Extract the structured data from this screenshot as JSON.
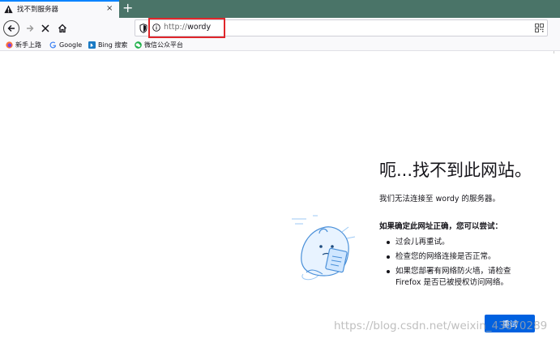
{
  "tab": {
    "title": "找不到服务器",
    "close": "×"
  },
  "tabstrip": {
    "new_tab": "+"
  },
  "urlbar": {
    "protocol": "http://",
    "host": "wordy"
  },
  "bookmarks": [
    {
      "label": "新手上路",
      "icon": "firefox-icon"
    },
    {
      "label": "Google",
      "icon": "google-icon"
    },
    {
      "label": "Bing 搜索",
      "icon": "bing-icon"
    },
    {
      "label": "微信公众平台",
      "icon": "wechat-icon"
    }
  ],
  "error": {
    "title": "呃...找不到此网站。",
    "description": "我们无法连接至 wordy 的服务器。",
    "tips_heading": "如果确定此网址正确，您可以尝试：",
    "tips": [
      "过会儿再重试。",
      "检查您的网络连接是否正常。",
      "如果您部署有网络防火墙，请检查",
      "Firefox 是否已被授权访问网络。"
    ],
    "try_again": "重试"
  },
  "watermark": "https://blog.csdn.net/weixin_43870289",
  "colors": {
    "tabstrip": "#4a7468",
    "accent": "#0061e0",
    "highlight": "#e0262b"
  }
}
